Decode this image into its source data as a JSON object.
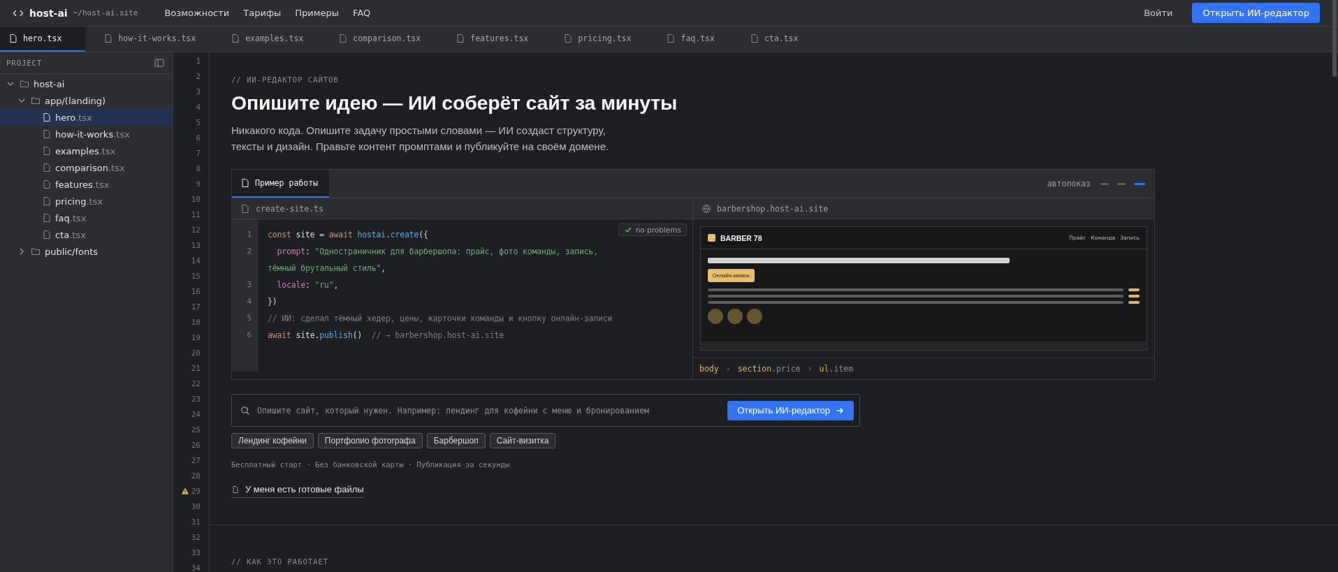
{
  "topbar": {
    "logo": "host-ai",
    "path": "~/host-ai.site",
    "nav": [
      "Возможности",
      "Тарифы",
      "Примеры",
      "FAQ"
    ],
    "login": "Войти",
    "cta": "Открыть ИИ-редактор"
  },
  "tabs": [
    {
      "label": "hero.tsx",
      "selected": true
    },
    {
      "label": "how-it-works.tsx",
      "selected": false
    },
    {
      "label": "examples.tsx",
      "selected": false
    },
    {
      "label": "comparison.tsx",
      "selected": false
    },
    {
      "label": "features.tsx",
      "selected": false
    },
    {
      "label": "pricing.tsx",
      "selected": false
    },
    {
      "label": "faq.tsx",
      "selected": false
    },
    {
      "label": "cta.tsx",
      "selected": false
    }
  ],
  "sidebar": {
    "title": "PROJECT",
    "tree": [
      {
        "kind": "folder",
        "name": "host-ai",
        "expanded": true,
        "children": [
          {
            "kind": "folder",
            "name": "app/(landing)",
            "expanded": true,
            "children": [
              {
                "kind": "file",
                "name": "hero",
                "ext": ".tsx",
                "selected": true
              },
              {
                "kind": "file",
                "name": "how-it-works",
                "ext": ".tsx",
                "selected": false
              },
              {
                "kind": "file",
                "name": "examples",
                "ext": ".tsx",
                "selected": false
              },
              {
                "kind": "file",
                "name": "comparison",
                "ext": ".tsx",
                "selected": false
              },
              {
                "kind": "file",
                "name": "features",
                "ext": ".tsx",
                "selected": false
              },
              {
                "kind": "file",
                "name": "pricing",
                "ext": ".tsx",
                "selected": false
              },
              {
                "kind": "file",
                "name": "faq",
                "ext": ".tsx",
                "selected": false
              },
              {
                "kind": "file",
                "name": "cta",
                "ext": ".tsx",
                "selected": false
              }
            ]
          },
          {
            "kind": "folder",
            "name": "public/fonts",
            "expanded": false
          }
        ]
      }
    ]
  },
  "gutter": [
    {
      "number": "1",
      "warning": false
    },
    {
      "number": "2",
      "warning": false
    },
    {
      "number": "3",
      "warning": false
    },
    {
      "number": "4",
      "warning": false
    },
    {
      "number": "5",
      "warning": false
    },
    {
      "number": "6",
      "warning": false
    },
    {
      "number": "7",
      "warning": false
    },
    {
      "number": "8",
      "warning": false
    },
    {
      "number": "9",
      "warning": false
    },
    {
      "number": "10",
      "warning": false
    },
    {
      "number": "11",
      "warning": false
    },
    {
      "number": "12",
      "warning": false
    },
    {
      "number": "13",
      "warning": false
    },
    {
      "number": "14",
      "warning": false
    },
    {
      "number": "15",
      "warning": false
    },
    {
      "number": "16",
      "warning": false
    },
    {
      "number": "17",
      "warning": false
    },
    {
      "number": "18",
      "warning": false
    },
    {
      "number": "19",
      "warning": false
    },
    {
      "number": "20",
      "warning": false
    },
    {
      "number": "21",
      "warning": false
    },
    {
      "number": "22",
      "warning": false
    },
    {
      "number": "23",
      "warning": false
    },
    {
      "number": "24",
      "warning": false
    },
    {
      "number": "25",
      "warning": false
    },
    {
      "number": "26",
      "warning": false
    },
    {
      "number": "27",
      "warning": false
    },
    {
      "number": "28",
      "warning": false
    },
    {
      "number": "29",
      "warning": true
    },
    {
      "number": "30",
      "warning": false
    },
    {
      "number": "31",
      "warning": false
    },
    {
      "number": "32",
      "warning": false
    },
    {
      "number": "33",
      "warning": false
    },
    {
      "number": "34",
      "warning": false
    }
  ],
  "hero": {
    "kicker": "// ИИ-РЕДАКТОР САЙТОВ",
    "title": "Опишите идею — ИИ соберёт сайт за минуты",
    "lead": "Никакого кода. Опишите задачу простыми словами — ИИ создаст структуру,\nтексты и дизайн. Правьте контент промптами и публикуйте на своём домене."
  },
  "demo": {
    "tab": {
      "label": "Пример работы",
      "selected": true
    },
    "autoplay": "автопоказ",
    "steps": [
      {
        "selected": false
      },
      {
        "selected": false
      },
      {
        "selected": true
      }
    ],
    "editor": {
      "filename": "create-site.ts",
      "status": "no problems",
      "lines": [
        {
          "number": "1",
          "tokens": [
            {
              "t": "const",
              "kind": "keyword"
            },
            {
              "t": " site = ",
              "kind": "plain"
            },
            {
              "t": "await ",
              "kind": "keyword"
            },
            {
              "t": "hostai",
              "kind": "fn"
            },
            {
              "t": ".",
              "kind": "plain"
            },
            {
              "t": "create",
              "kind": "fn"
            },
            {
              "t": "({",
              "kind": "plain"
            }
          ]
        },
        {
          "number": "2",
          "tokens": [
            {
              "t": "  prompt",
              "kind": "prop"
            },
            {
              "t": ": ",
              "kind": "plain"
            },
            {
              "t": "\"Одностраничник для барбершопа: прайс, фото команды, запись,",
              "kind": "string"
            }
          ]
        },
        {
          "tokens": [
            {
              "t": "тёмный брутальный стиль\"",
              "kind": "string"
            },
            {
              "t": ",",
              "kind": "plain"
            }
          ]
        },
        {
          "number": "3",
          "tokens": [
            {
              "t": "  locale",
              "kind": "prop"
            },
            {
              "t": ": ",
              "kind": "plain"
            },
            {
              "t": "\"ru\"",
              "kind": "string"
            },
            {
              "t": ",",
              "kind": "plain"
            }
          ]
        },
        {
          "number": "4",
          "tokens": [
            {
              "t": "})",
              "kind": "plain"
            }
          ]
        },
        {
          "number": "5",
          "tokens": [
            {
              "t": "// ИИ: сделал тёмный хедер, цены, карточки команды и кнопку онлайн-записи",
              "kind": "comment"
            }
          ]
        },
        {
          "number": "6",
          "tokens": [
            {
              "t": "await",
              "kind": "keyword"
            },
            {
              "t": " site.",
              "kind": "plain"
            },
            {
              "t": "publish",
              "kind": "fn"
            },
            {
              "t": "()  ",
              "kind": "plain"
            },
            {
              "t": "// → barbershop.host-ai.site",
              "kind": "comment"
            }
          ]
        }
      ]
    },
    "preview": {
      "url": "barbershop.host-ai.site",
      "brand": "BARBER 78",
      "nav": "Прайс · Команда · Запись",
      "button": "Онлайн-запись"
    },
    "breadcrumb": [
      {
        "tag": "body"
      },
      {
        "separator": "›"
      },
      {
        "tag": "section",
        "cls": ".price"
      },
      {
        "separator": "›"
      },
      {
        "tag": "ul",
        "cls": ".item"
      }
    ]
  },
  "prompt": {
    "placeholder": "Опишите сайт, который нужен. Например: лендинг для кофейни с меню и бронированием",
    "button": "Открыть ИИ-редактор"
  },
  "chips": [
    "Лендинг кофейни",
    "Портфолио фотографа",
    "Барбершоп",
    "Сайт-визитка"
  ],
  "perks": "Бесплатный старт · Без банковской карты · Публикация за секунды",
  "files_link": "У меня есть готовые файлы",
  "next_kicker": "// КАК ЭТО РАБОТАЕТ"
}
